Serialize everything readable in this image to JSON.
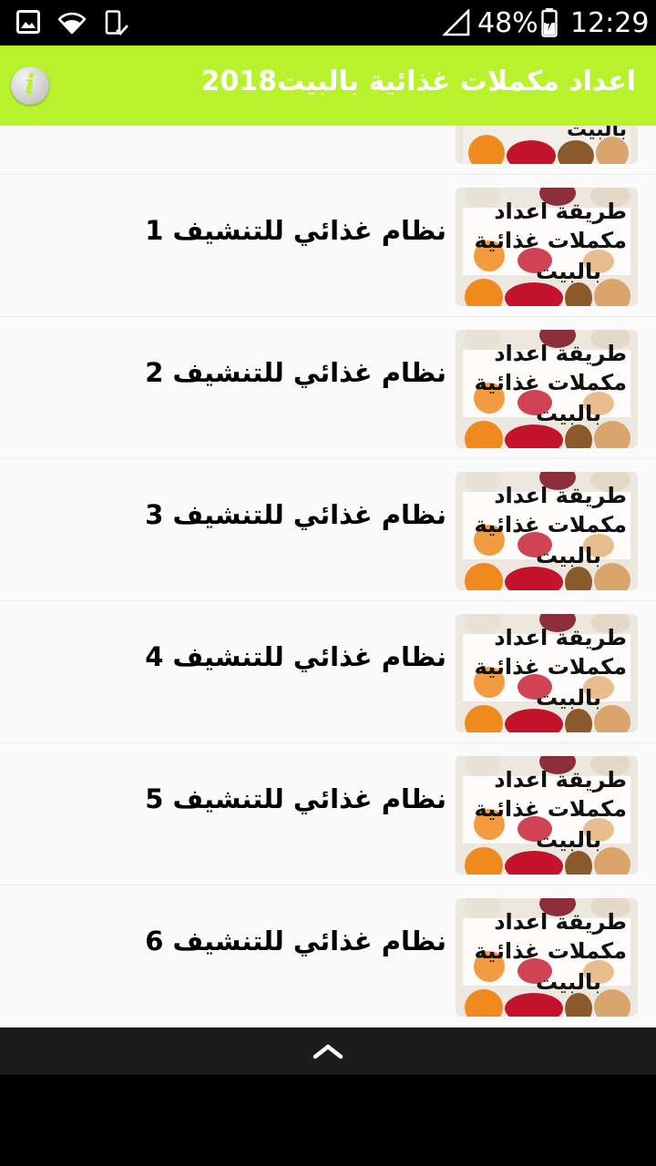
{
  "status_bar": {
    "battery_percent": "48%",
    "time": "12:29",
    "icons": [
      "gallery-icon",
      "wifi-icon",
      "phone-screen-icon",
      "signal-icon",
      "battery-icon"
    ]
  },
  "app_bar": {
    "title": "اعداد مكملات غذائية بالبيت2018",
    "info_icon": "info-icon",
    "info_glyph": "i",
    "color": "#b8f22c"
  },
  "thumbnail": {
    "line1": "طريقة اعداد",
    "line2": "مكملات غذائية",
    "line3": "بالبيت"
  },
  "partial_item": {
    "thumb_text": "بالبيت"
  },
  "items": [
    {
      "label": "نظام غذائي للتنشيف 1"
    },
    {
      "label": "نظام غذائي للتنشيف 2"
    },
    {
      "label": "نظام غذائي للتنشيف 3"
    },
    {
      "label": "نظام غذائي للتنشيف 4"
    },
    {
      "label": "نظام غذائي للتنشيف 5"
    },
    {
      "label": "نظام غذائي للتنشيف 6"
    }
  ],
  "nav_bar": {
    "icon": "chevron-up-icon"
  }
}
